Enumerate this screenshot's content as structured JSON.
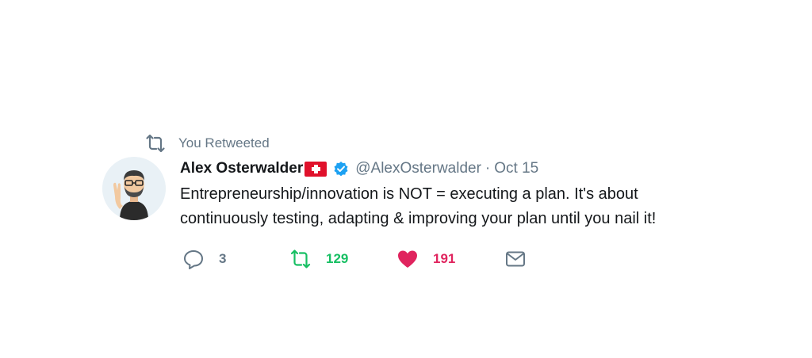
{
  "context": {
    "icon": "retweet-icon",
    "label": "You Retweeted"
  },
  "tweet": {
    "author": {
      "name": "Alex Osterwalder",
      "flag_icon": "swiss-flag-icon",
      "verified_icon": "verified-badge-icon",
      "handle": "@AlexOsterwalder",
      "separator": "·",
      "date": "Oct 15"
    },
    "text_lines": [
      "Entrepreneurship/innovation is NOT = executing a plan. It's about",
      "continuously testing, adapting & improving your plan until you nail it!"
    ],
    "actions": {
      "reply": {
        "icon": "reply-icon",
        "count": "3"
      },
      "retweet": {
        "icon": "retweet-icon",
        "count": "129"
      },
      "like": {
        "icon": "heart-icon",
        "count": "191"
      },
      "dm": {
        "icon": "envelope-icon"
      }
    }
  },
  "colors": {
    "text": "#14171a",
    "secondary": "#657786",
    "retweet_green": "#17bf63",
    "like_red": "#e0245e",
    "verified_blue": "#1da1f2",
    "flag_red": "#e0112b"
  }
}
